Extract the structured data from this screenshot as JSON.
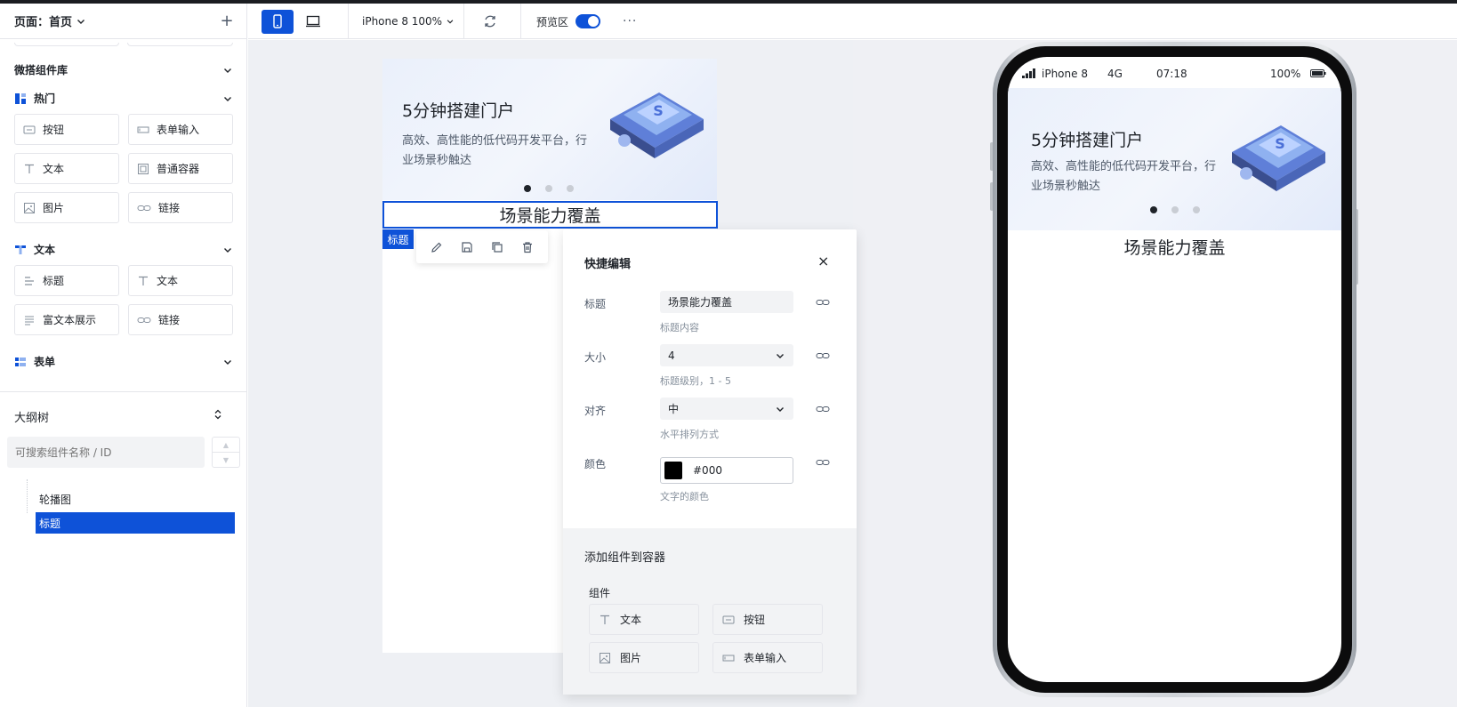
{
  "sidebar": {
    "page_label": "页面：首页",
    "add_label": "+",
    "library_title": "微搭组件库",
    "groups": [
      {
        "title": "热门",
        "icon": "grid-icon",
        "items": [
          "按钮",
          "表单输入",
          "文本",
          "普通容器",
          "图片",
          "链接"
        ]
      },
      {
        "title": "文本",
        "icon": "text-t-icon",
        "items": [
          "标题",
          "文本",
          "富文本展示",
          "链接"
        ]
      },
      {
        "title": "表单",
        "icon": "form-icon",
        "items": []
      }
    ]
  },
  "outline": {
    "title": "大纲树",
    "search_placeholder": "可搜索组件名称 / ID",
    "items": [
      "轮播图",
      "标题"
    ],
    "selected_index": 1
  },
  "toolbar": {
    "device_label": "iPhone 8 100%",
    "preview_label": "预览区",
    "more_label": "···",
    "preview_on": true
  },
  "canvas": {
    "banner_title": "5分钟搭建门户",
    "banner_sub": "高效、高性能的低代码开发平台，行业场景秒触达",
    "heading": "场景能力覆盖",
    "heading_tag": "标题"
  },
  "quick_edit": {
    "title": "快捷编辑",
    "close_label": "×",
    "fields": [
      {
        "label": "标题",
        "value": "场景能力覆盖",
        "hint": "标题内容"
      },
      {
        "label": "大小",
        "value": "4",
        "hint": "标题级别，1 - 5"
      },
      {
        "label": "对齐",
        "value": "中",
        "hint": "水平排列方式"
      },
      {
        "label": "颜色",
        "value": "#000",
        "hint": "文字的颜色"
      }
    ],
    "add_title": "添加组件到容器",
    "add_sub": "组件",
    "components": [
      "文本",
      "按钮",
      "图片",
      "表单输入"
    ]
  },
  "phone": {
    "carrier": "iPhone 8",
    "network": "4G",
    "time": "07:18",
    "battery": "100%"
  },
  "colors": {
    "accent": "#0e52d8",
    "swatch": "#000000"
  }
}
